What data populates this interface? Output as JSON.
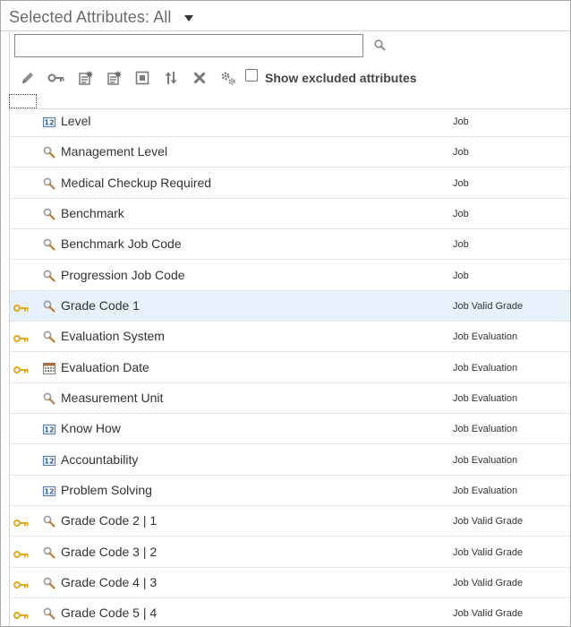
{
  "header": {
    "title": "Selected Attributes: All"
  },
  "search": {
    "value": "",
    "placeholder": ""
  },
  "toolbar": {
    "icons": [
      "edit-icon",
      "key-icon",
      "new-attribute-icon",
      "new-attribute-alt-icon",
      "select-box-icon",
      "sort-icon",
      "delete-icon",
      "settings-icon"
    ],
    "show_excluded_label": "Show excluded attributes",
    "show_excluded_checked": false
  },
  "colors": {
    "selected_row": "#e6f1fb",
    "key": "#e6a817",
    "search_icon": "#8a8a8a"
  },
  "rows": [
    {
      "name": "Level",
      "object": "Job",
      "icon": "number-icon",
      "key": false,
      "selected": false
    },
    {
      "name": "Management Level",
      "object": "Job",
      "icon": "lookup-icon",
      "key": false,
      "selected": false
    },
    {
      "name": "Medical Checkup Required",
      "object": "Job",
      "icon": "lookup-icon",
      "key": false,
      "selected": false
    },
    {
      "name": "Benchmark",
      "object": "Job",
      "icon": "lookup-icon",
      "key": false,
      "selected": false
    },
    {
      "name": "Benchmark Job Code",
      "object": "Job",
      "icon": "lookup-icon",
      "key": false,
      "selected": false
    },
    {
      "name": "Progression Job Code",
      "object": "Job",
      "icon": "lookup-icon",
      "key": false,
      "selected": false
    },
    {
      "name": "Grade Code 1",
      "object": "Job Valid Grade",
      "icon": "lookup-icon",
      "key": true,
      "selected": true
    },
    {
      "name": "Evaluation System",
      "object": "Job Evaluation",
      "icon": "lookup-icon",
      "key": true,
      "selected": false
    },
    {
      "name": "Evaluation Date",
      "object": "Job Evaluation",
      "icon": "calendar-icon",
      "key": true,
      "selected": false
    },
    {
      "name": "Measurement Unit",
      "object": "Job Evaluation",
      "icon": "lookup-icon",
      "key": false,
      "selected": false
    },
    {
      "name": "Know How",
      "object": "Job Evaluation",
      "icon": "number-icon",
      "key": false,
      "selected": false
    },
    {
      "name": "Accountability",
      "object": "Job Evaluation",
      "icon": "number-icon",
      "key": false,
      "selected": false
    },
    {
      "name": "Problem Solving",
      "object": "Job Evaluation",
      "icon": "number-icon",
      "key": false,
      "selected": false
    },
    {
      "name": "Grade Code 2 | 1",
      "object": "Job Valid Grade",
      "icon": "lookup-icon",
      "key": true,
      "selected": false
    },
    {
      "name": "Grade Code 3 | 2",
      "object": "Job Valid Grade",
      "icon": "lookup-icon",
      "key": true,
      "selected": false
    },
    {
      "name": "Grade Code 4 | 3",
      "object": "Job Valid Grade",
      "icon": "lookup-icon",
      "key": true,
      "selected": false
    },
    {
      "name": "Grade Code 5 | 4",
      "object": "Job Valid Grade",
      "icon": "lookup-icon",
      "key": true,
      "selected": false
    }
  ]
}
